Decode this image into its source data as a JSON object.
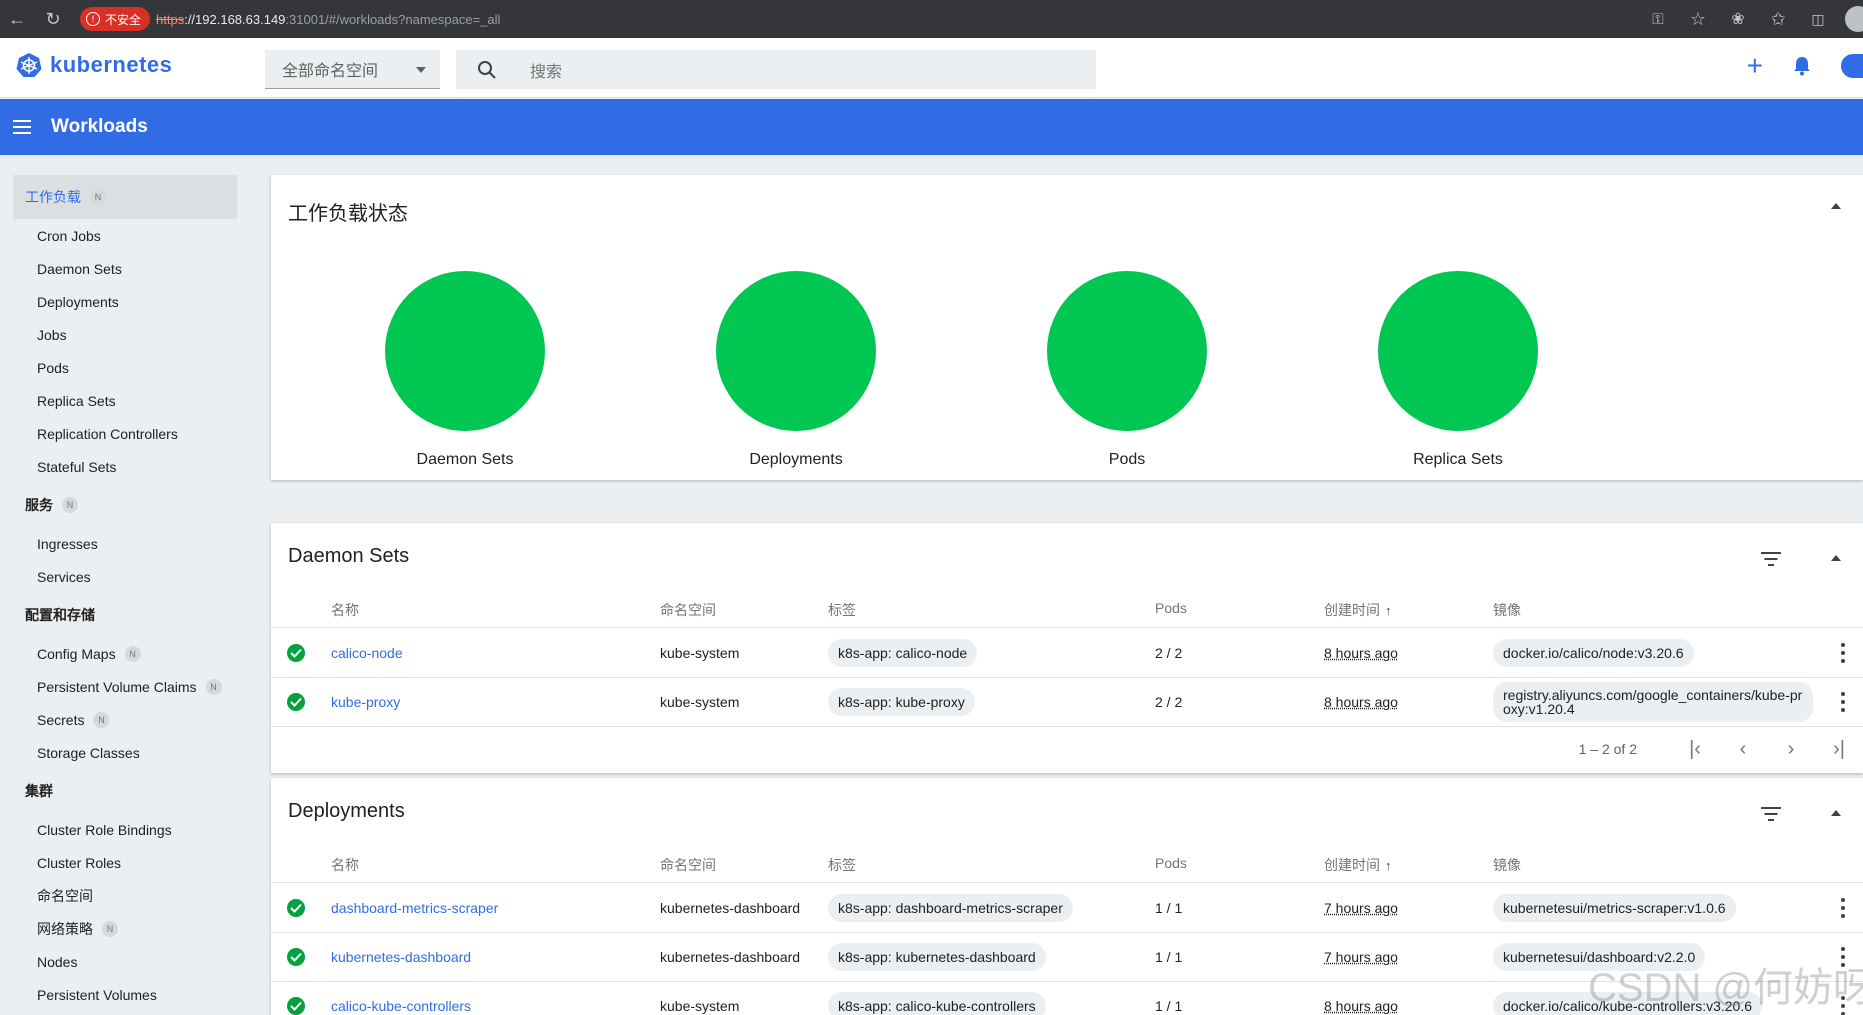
{
  "browser": {
    "insecure_label": "不安全",
    "url_proto": "https",
    "url_host": "://192.168.63.149",
    "url_path": ":31001/#/workloads?namespace=_all"
  },
  "header": {
    "logo_text": "kubernetes",
    "namespace_selected": "全部命名空间",
    "search_placeholder": "搜索"
  },
  "toolbar": {
    "title": "Workloads"
  },
  "sidebar": {
    "active_section": {
      "label": "工作负载",
      "badge": "N"
    },
    "workloads": [
      "Cron Jobs",
      "Daemon Sets",
      "Deployments",
      "Jobs",
      "Pods",
      "Replica Sets",
      "Replication Controllers",
      "Stateful Sets"
    ],
    "service_section": {
      "label": "服务",
      "badge": "N"
    },
    "services": [
      "Ingresses",
      "Services"
    ],
    "config_section": {
      "label": "配置和存储"
    },
    "config": [
      {
        "label": "Config Maps",
        "badge": "N"
      },
      {
        "label": "Persistent Volume Claims",
        "badge": "N"
      },
      {
        "label": "Secrets",
        "badge": "N"
      },
      {
        "label": "Storage Classes",
        "badge": ""
      }
    ],
    "cluster_section": {
      "label": "集群"
    },
    "cluster": [
      {
        "label": "Cluster Role Bindings",
        "badge": ""
      },
      {
        "label": "Cluster Roles",
        "badge": ""
      },
      {
        "label": "命名空间",
        "badge": ""
      },
      {
        "label": "网络策略",
        "badge": "N"
      },
      {
        "label": "Nodes",
        "badge": ""
      },
      {
        "label": "Persistent Volumes",
        "badge": ""
      }
    ]
  },
  "status_card": {
    "title": "工作负载状态",
    "items": [
      "Daemon Sets",
      "Deployments",
      "Pods",
      "Replica Sets"
    ],
    "status_color": "#00c752"
  },
  "columns": {
    "name": "名称",
    "namespace": "命名空间",
    "labels": "标签",
    "pods": "Pods",
    "created": "创建时间",
    "images": "镜像"
  },
  "daemon_sets": {
    "title": "Daemon Sets",
    "rows": [
      {
        "name": "calico-node",
        "namespace": "kube-system",
        "label": "k8s-app: calico-node",
        "pods": "2 / 2",
        "created": "8 hours ago",
        "image": "docker.io/calico/node:v3.20.6"
      },
      {
        "name": "kube-proxy",
        "namespace": "kube-system",
        "label": "k8s-app: kube-proxy",
        "pods": "2 / 2",
        "created": "8 hours ago",
        "image": "registry.aliyuncs.com/google_containers/kube-proxy:v1.20.4"
      }
    ],
    "pager": "1 – 2 of 2"
  },
  "deployments": {
    "title": "Deployments",
    "rows": [
      {
        "name": "dashboard-metrics-scraper",
        "namespace": "kubernetes-dashboard",
        "label": "k8s-app: dashboard-metrics-scraper",
        "pods": "1 / 1",
        "created": "7 hours ago",
        "image": "kubernetesui/metrics-scraper:v1.0.6"
      },
      {
        "name": "kubernetes-dashboard",
        "namespace": "kubernetes-dashboard",
        "label": "k8s-app: kubernetes-dashboard",
        "pods": "1 / 1",
        "created": "7 hours ago",
        "image": "kubernetesui/dashboard:v2.2.0"
      },
      {
        "name": "calico-kube-controllers",
        "namespace": "kube-system",
        "label": "k8s-app: calico-kube-controllers",
        "pods": "1 / 1",
        "created": "8 hours ago",
        "image": "docker.io/calico/kube-controllers:v3.20.6"
      }
    ]
  },
  "watermark": "CSDN @何妨呀~",
  "colors": {
    "brand": "#326ce5",
    "ok": "#00a33e"
  }
}
